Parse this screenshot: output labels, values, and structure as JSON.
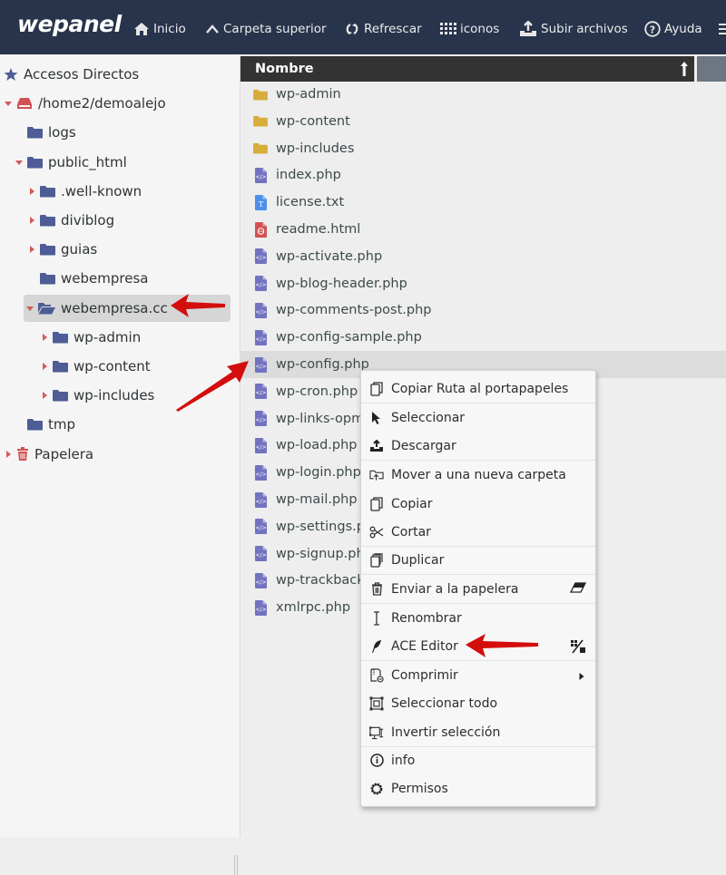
{
  "app": {
    "logo": "wepanel"
  },
  "toolbar": {
    "items": [
      {
        "label": "Inicio",
        "icon": "home-icon"
      },
      {
        "label": "Carpeta superior",
        "icon": "chevron-up-icon"
      },
      {
        "label": "Refrescar",
        "icon": "refresh-icon"
      },
      {
        "label": "iconos",
        "icon": "grid-icon"
      },
      {
        "label": "Subir archivos",
        "icon": "upload-icon"
      },
      {
        "label": "Ayuda",
        "icon": "help-icon"
      }
    ],
    "more_icon": "more-icon"
  },
  "sidebar": {
    "items": [
      {
        "label": "Accesos Directos",
        "icon": "star-icon",
        "caret": "none",
        "level": 0
      },
      {
        "label": "/home2/demoalejo",
        "icon": "drive-icon",
        "caret": "down",
        "level": 0
      },
      {
        "label": "logs",
        "icon": "folder-icon",
        "caret": "none",
        "level": 1
      },
      {
        "label": "public_html",
        "icon": "folder-icon",
        "caret": "down",
        "level": 1
      },
      {
        "label": ".well-known",
        "icon": "folder-icon",
        "caret": "right",
        "level": 2
      },
      {
        "label": "diviblog",
        "icon": "folder-icon",
        "caret": "right",
        "level": 2
      },
      {
        "label": "guias",
        "icon": "folder-icon",
        "caret": "right",
        "level": 2
      },
      {
        "label": "webempresa",
        "icon": "folder-icon",
        "caret": "none",
        "level": 2
      },
      {
        "label": "webempresa.cc",
        "icon": "folder-open-icon",
        "caret": "down",
        "level": 2,
        "selected": true
      },
      {
        "label": "wp-admin",
        "icon": "folder-icon",
        "caret": "right",
        "level": 3
      },
      {
        "label": "wp-content",
        "icon": "folder-icon",
        "caret": "right",
        "level": 3
      },
      {
        "label": "wp-includes",
        "icon": "folder-icon",
        "caret": "right",
        "level": 3
      },
      {
        "label": "tmp",
        "icon": "folder-icon",
        "caret": "none",
        "level": 1
      },
      {
        "label": "Papelera",
        "icon": "trash-icon",
        "caret": "right",
        "level": 0
      }
    ]
  },
  "file_list": {
    "column_header": "Nombre",
    "sort": "ascending",
    "files": [
      {
        "name": "wp-admin",
        "type": "folder"
      },
      {
        "name": "wp-content",
        "type": "folder"
      },
      {
        "name": "wp-includes",
        "type": "folder"
      },
      {
        "name": "index.php",
        "type": "php"
      },
      {
        "name": "license.txt",
        "type": "txt"
      },
      {
        "name": "readme.html",
        "type": "html"
      },
      {
        "name": "wp-activate.php",
        "type": "php"
      },
      {
        "name": "wp-blog-header.php",
        "type": "php"
      },
      {
        "name": "wp-comments-post.php",
        "type": "php"
      },
      {
        "name": "wp-config-sample.php",
        "type": "php"
      },
      {
        "name": "wp-config.php",
        "type": "php",
        "highlighted": true
      },
      {
        "name": "wp-cron.php",
        "type": "php"
      },
      {
        "name": "wp-links-opml.php",
        "type": "php"
      },
      {
        "name": "wp-load.php",
        "type": "php"
      },
      {
        "name": "wp-login.php",
        "type": "php"
      },
      {
        "name": "wp-mail.php",
        "type": "php"
      },
      {
        "name": "wp-settings.php",
        "type": "php"
      },
      {
        "name": "wp-signup.php",
        "type": "php"
      },
      {
        "name": "wp-trackback.php",
        "type": "php"
      },
      {
        "name": "xmlrpc.php",
        "type": "php"
      }
    ]
  },
  "context_menu": {
    "items": [
      {
        "label": "Copiar Ruta al portapapeles",
        "icon": "copy-icon"
      },
      {
        "label": "Seleccionar",
        "icon": "cursor-icon"
      },
      {
        "label": "Descargar",
        "icon": "download-icon"
      },
      {
        "label": "Mover a una nueva carpeta",
        "icon": "move-folder-icon"
      },
      {
        "label": "Copiar",
        "icon": "copy-icon"
      },
      {
        "label": "Cortar",
        "icon": "scissors-icon"
      },
      {
        "label": "Duplicar",
        "icon": "duplicate-icon"
      },
      {
        "label": "Enviar a la papelera",
        "icon": "trash-icon",
        "shortcut_icon": "eraser-icon"
      },
      {
        "label": "Renombrar",
        "icon": "text-cursor-icon"
      },
      {
        "label": "ACE Editor",
        "icon": "feather-icon",
        "shortcut_icon": "edit-grid-icon"
      },
      {
        "label": "Comprimir",
        "icon": "compress-icon",
        "submenu": true
      },
      {
        "label": "Seleccionar todo",
        "icon": "select-all-icon"
      },
      {
        "label": "Invertir selección",
        "icon": "invert-selection-icon"
      },
      {
        "label": "info",
        "icon": "info-icon"
      },
      {
        "label": "Permisos",
        "icon": "gear-icon"
      }
    ]
  },
  "colors": {
    "topbar": "#27344b",
    "folder_tree": "#4e5d95",
    "folder_list": "#d8ad3c",
    "php_icon": "#7273c0",
    "txt_icon": "#4d8fe8",
    "html_icon": "#d25252",
    "caret": "#d45a5a",
    "annotation_arrow": "#d40d0d"
  }
}
